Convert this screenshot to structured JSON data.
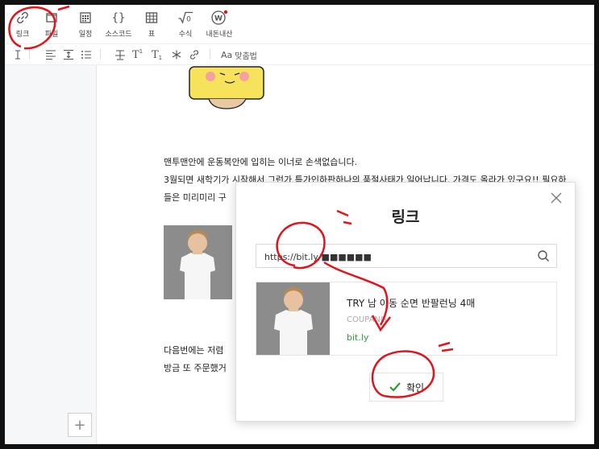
{
  "toolbar": {
    "items": [
      {
        "label": "링크",
        "icon": "link-icon"
      },
      {
        "label": "파일",
        "icon": "file-icon"
      },
      {
        "label": "일정",
        "icon": "calendar-icon"
      },
      {
        "label": "소스코드",
        "icon": "code-braces-icon"
      },
      {
        "label": "표",
        "icon": "table-icon"
      },
      {
        "label": "수식",
        "icon": "formula-icon"
      },
      {
        "label": "내돈내산",
        "icon": "own-purchase-icon"
      }
    ]
  },
  "subtoolbar": {
    "spellcheck_label": "맞춤법",
    "superscript_label": "T",
    "subscript_label": "T"
  },
  "editor": {
    "paragraphs": [
      "맨투맨안에 운동복안에 입히는 이너로 손색없습니다.",
      "3월되면 새학기가 시작해서 그런가 특가인하판하나의 품절사태가 일어납니다. 가격도 올라가 있구요!! 필요하",
      "들은 미리미리 구",
      "다음번에는 저렴",
      "방금 또 주문했거"
    ],
    "add_button": "+"
  },
  "modal": {
    "title": "링크",
    "url_value": "https://bit.ly/■■■■■■",
    "preview": {
      "title": "TRY 남 아동 순면 반팔런닝 4매",
      "site": "COUPANG",
      "domain": "bit.ly"
    },
    "confirm_label": "확인"
  },
  "colors": {
    "accent_green": "#2a9e37",
    "annotation_red": "#e0141c"
  }
}
